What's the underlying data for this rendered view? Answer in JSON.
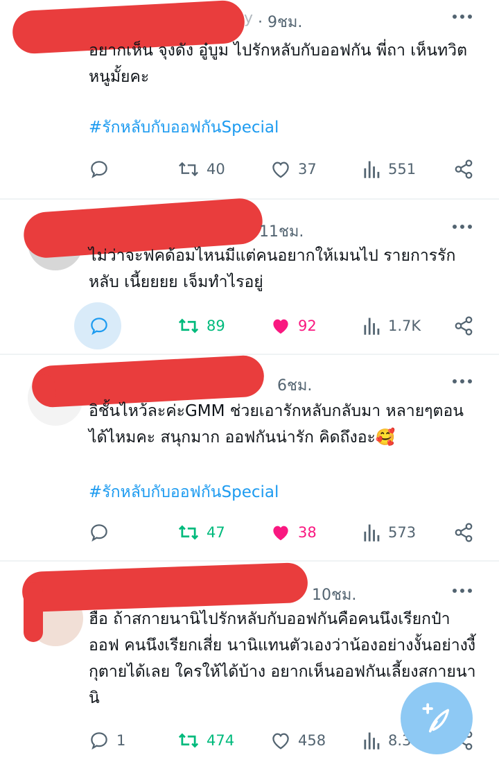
{
  "tweets": [
    {
      "handle_fragment": "y",
      "time": "· 9ชม.",
      "text": "อยากเห็น จุงดัง อู๋บูม ไปรักหลับกับออฟกัน พี่ถา เห็นทวิตหนูมั้ยคะ",
      "hashtag": "#รักหลับกับออฟกันSpecial",
      "replies": "",
      "retweets": "40",
      "likes": "37",
      "views": "551"
    },
    {
      "handle_fragment": "",
      "time": "11ชม.",
      "text": "ไม่ว่าจะฟคด้อมไหนมีแต่คนอยากให้เมนไป รายการรักหลับ เนี้ยยยย เจ็มทำไรอยู่",
      "hashtag": "",
      "replies": "",
      "retweets": "89",
      "likes": "92",
      "views": "1.7K"
    },
    {
      "handle_fragment": "",
      "time": "6ชม.",
      "text": "อิชั้นไหว้ละค่ะGMM ช่วยเอารักหลับกลับมา หลายๆตอนได้ไหมคะ สนุกมาก ออฟกันน่ารัก คิดถึงอะ🥰",
      "hashtag": "#รักหลับกับออฟกันSpecial",
      "replies": "",
      "retweets": "47",
      "likes": "38",
      "views": "573"
    },
    {
      "handle_fragment": "",
      "time": "10ชม.",
      "text": "ฮือ ถ้าสกายนานิไปรักหลับกับออฟกันคือคนนึงเรียกป๋าออฟ คนนึงเรียกเสี่ย นานิแทนตัวเองว่าน้องอย่างงั้นอย่างงี้ กุตายได้เลย ใครให้ได้บ้าง อยากเห็นออฟกันเลี้ยงสกายนานิ",
      "hashtag": "",
      "replies": "1",
      "retweets": "474",
      "likes": "458",
      "views": "8.3K"
    }
  ],
  "colors": {
    "text": "#0f1419",
    "muted": "#536471",
    "link": "#1d9bf0",
    "retweet_active": "#00ba7c",
    "like_active": "#f91880",
    "redaction": "#e93d3d"
  },
  "icons": [
    "reply-icon",
    "retweet-icon",
    "like-icon",
    "views-icon",
    "share-icon",
    "more-icon",
    "compose-icon"
  ]
}
